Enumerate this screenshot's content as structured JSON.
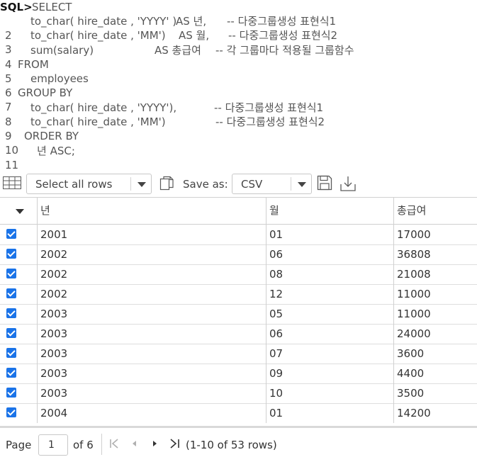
{
  "sql": {
    "prompt": "SQL>",
    "lines": [
      {
        "num": "",
        "code": "SELECT",
        "alias": "",
        "comment": ""
      },
      {
        "num": "2",
        "code": "to_char( hire_date , 'YYYY' )",
        "alias": "AS 년,",
        "comment": "-- 다중그룹생성 표현식1"
      },
      {
        "num": "3",
        "code": "to_char( hire_date , 'MM')",
        "alias": "AS 월,",
        "comment": "-- 다중그룹생성 표현식2"
      },
      {
        "num": "4",
        "code": "sum(salary)",
        "alias": "AS 총급여",
        "comment": "-- 각 그룹마다 적용될 그룹함수"
      },
      {
        "num": "5",
        "code": "FROM",
        "alias": "",
        "comment": ""
      },
      {
        "num": "6",
        "code": "employees",
        "alias": "",
        "comment": ""
      },
      {
        "num": "7",
        "code": "GROUP BY",
        "alias": "",
        "comment": ""
      },
      {
        "num": "8",
        "code": "to_char( hire_date , 'YYYY'),",
        "alias": "",
        "comment": "-- 다중그룹생성 표현식1"
      },
      {
        "num": "9",
        "code": "to_char( hire_date , 'MM')",
        "alias": "",
        "comment": "-- 다중그룹생성 표현식2"
      },
      {
        "num": "10",
        "code": "ORDER BY",
        "alias": "",
        "comment": ""
      },
      {
        "num": "11",
        "code": "년 ASC;",
        "alias": "",
        "comment": ""
      }
    ]
  },
  "toolbar": {
    "select_rows": "Select all rows",
    "save_as_label": "Save as:",
    "format": "CSV",
    "icons": [
      "table-grid-icon",
      "copy-icon",
      "save-icon",
      "download-icon"
    ]
  },
  "table": {
    "columns": [
      "년",
      "월",
      "총급여"
    ],
    "rows": [
      {
        "year": "2001",
        "month": "01",
        "total": "17000"
      },
      {
        "year": "2002",
        "month": "06",
        "total": "36808"
      },
      {
        "year": "2002",
        "month": "08",
        "total": "21008"
      },
      {
        "year": "2002",
        "month": "12",
        "total": "11000"
      },
      {
        "year": "2003",
        "month": "05",
        "total": "11000"
      },
      {
        "year": "2003",
        "month": "06",
        "total": "24000"
      },
      {
        "year": "2003",
        "month": "07",
        "total": "3600"
      },
      {
        "year": "2003",
        "month": "09",
        "total": "4400"
      },
      {
        "year": "2003",
        "month": "10",
        "total": "3500"
      },
      {
        "year": "2004",
        "month": "01",
        "total": "14200"
      }
    ]
  },
  "pager": {
    "page_label": "Page",
    "page_value": "1",
    "of_label": "of 6",
    "range_text": "(1-10 of 53 rows)"
  },
  "colors": {
    "checkbox": "#1a73e8"
  }
}
